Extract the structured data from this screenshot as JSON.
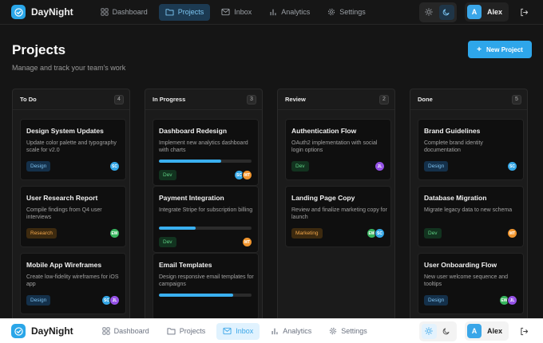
{
  "app": {
    "name": "DayNight",
    "accent": "#2ea6ea"
  },
  "nav": [
    {
      "label": "Dashboard",
      "icon": "grid-icon"
    },
    {
      "label": "Projects",
      "icon": "folder-icon"
    },
    {
      "label": "Inbox",
      "icon": "mail-icon"
    },
    {
      "label": "Analytics",
      "icon": "bar-chart-icon"
    },
    {
      "label": "Settings",
      "icon": "gear-icon"
    }
  ],
  "top_nav_active": "Projects",
  "bottom_nav_active": "Inbox",
  "user": {
    "initial": "A",
    "name": "Alex"
  },
  "page": {
    "title": "Projects",
    "subtitle": "Manage and track your team's work",
    "new_button": "New Project"
  },
  "columns": [
    {
      "title": "To Do",
      "count": "4",
      "cards": [
        {
          "title": "Design System Updates",
          "desc": "Update color palette and typography scale for v2.0",
          "tag": "Design",
          "assignees": [
            "SC"
          ]
        },
        {
          "title": "User Research Report",
          "desc": "Compile findings from Q4 user interviews",
          "tag": "Research",
          "assignees": [
            "EW"
          ]
        },
        {
          "title": "Mobile App Wireframes",
          "desc": "Create low-fidelity wireframes for iOS app",
          "tag": "Design",
          "assignees": [
            "SC",
            "JL"
          ]
        }
      ]
    },
    {
      "title": "In Progress",
      "count": "3",
      "cards": [
        {
          "title": "Dashboard Redesign",
          "desc": "Implement new analytics dashboard with charts",
          "progress": 0.67,
          "tag": "Dev",
          "assignees": [
            "SC",
            "MT"
          ]
        },
        {
          "title": "Payment Integration",
          "desc": "Integrate Stripe for subscription billing",
          "progress": 0.4,
          "tag": "Dev",
          "assignees": [
            "MT"
          ]
        },
        {
          "title": "Email Templates",
          "desc": "Design responsive email templates for campaigns",
          "progress": 0.8,
          "tag": "",
          "assignees": []
        }
      ]
    },
    {
      "title": "Review",
      "count": "2",
      "cards": [
        {
          "title": "Authentication Flow",
          "desc": "OAuth2 implementation with social login options",
          "tag": "Dev",
          "assignees": [
            "JL"
          ]
        },
        {
          "title": "Landing Page Copy",
          "desc": "Review and finalize marketing copy for launch",
          "tag": "Marketing",
          "assignees": [
            "EW",
            "SC"
          ]
        }
      ]
    },
    {
      "title": "Done",
      "count": "5",
      "cards": [
        {
          "title": "Brand Guidelines",
          "desc": "Complete brand identity documentation",
          "tag": "Design",
          "assignees": [
            "SC"
          ]
        },
        {
          "title": "Database Migration",
          "desc": "Migrate legacy data to new schema",
          "tag": "Dev",
          "assignees": [
            "MT"
          ]
        },
        {
          "title": "User Onboarding Flow",
          "desc": "New user welcome sequence and tooltips",
          "tag": "Design",
          "assignees": [
            "EW",
            "JL"
          ]
        }
      ]
    }
  ]
}
